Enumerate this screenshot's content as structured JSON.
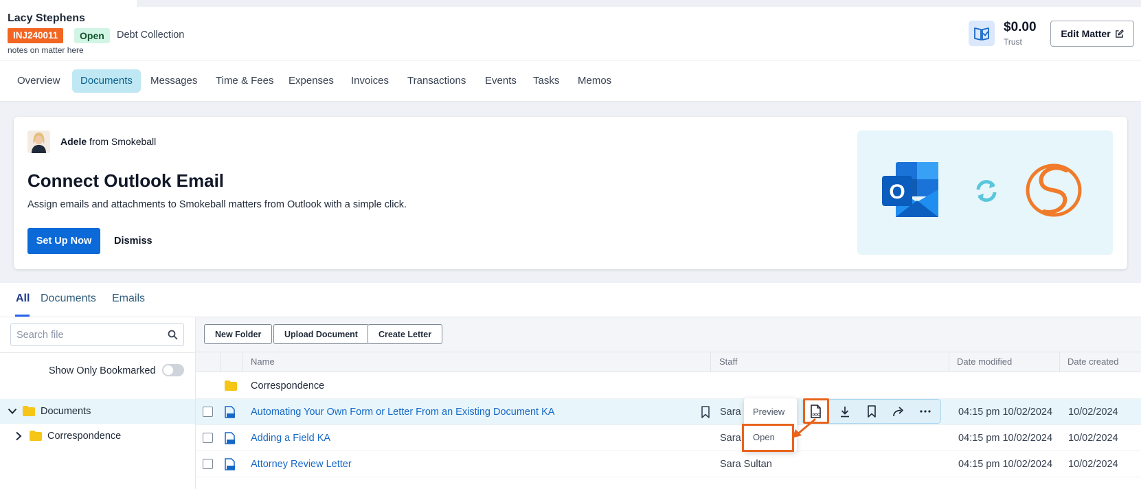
{
  "header": {
    "client_name": "Lacy Stephens",
    "matter_number": "INJ240011",
    "status": "Open",
    "matter_type": "Debt Collection",
    "notes": "notes on matter here",
    "trust_amount": "$0.00",
    "trust_label": "Trust",
    "edit_label": "Edit Matter"
  },
  "tabs": [
    "Overview",
    "Documents",
    "Messages",
    "Time & Fees",
    "Expenses",
    "Invoices",
    "Transactions",
    "Events",
    "Tasks",
    "Memos"
  ],
  "active_tab": "Documents",
  "promo": {
    "sender": "Adele",
    "from_text": "from Smokeball",
    "title": "Connect Outlook Email",
    "description": "Assign emails and attachments to Smokeball matters from Outlook with a simple click.",
    "primary_button": "Set Up Now",
    "secondary_button": "Dismiss",
    "outlook_letter": "O"
  },
  "sub_tabs": [
    "All",
    "Documents",
    "Emails"
  ],
  "sidebar": {
    "search_placeholder": "Search file",
    "bookmark_toggle_label": "Show Only Bookmarked",
    "tree": [
      {
        "label": "Documents",
        "expanded": true,
        "selected": true
      },
      {
        "label": "Correspondence",
        "expanded": false,
        "selected": false
      }
    ]
  },
  "toolbar": {
    "new_folder": "New Folder",
    "upload": "Upload Document",
    "create_letter": "Create Letter"
  },
  "columns": {
    "name": "Name",
    "staff": "Staff",
    "modified": "Date modified",
    "created": "Date created"
  },
  "folder_row": {
    "name": "Correspondence"
  },
  "documents": [
    {
      "name": "Automating Your Own Form or Letter From an Existing Document KA",
      "staff": "Sara S",
      "modified": "04:15 pm 10/02/2024",
      "created": "10/02/2024"
    },
    {
      "name": "Adding a Field KA",
      "staff": "Sara",
      "modified": "04:15 pm 10/02/2024",
      "created": "10/02/2024"
    },
    {
      "name": "Attorney Review Letter",
      "staff": "Sara Sultan",
      "modified": "04:15 pm 10/02/2024",
      "created": "10/02/2024"
    }
  ],
  "context_menu": {
    "preview": "Preview",
    "open": "Open"
  },
  "doc_icon_text": "DOC",
  "colors": {
    "matter_orange": "#f26522",
    "status_green_bg": "#d1f5e4",
    "primary_blue": "#0b6ad8",
    "link_blue": "#1668c7",
    "active_tab_bg": "#bfe8f4",
    "highlight": "#e8631c",
    "folder_yellow": "#f5c518",
    "smokeball_orange": "#f07b2a"
  }
}
